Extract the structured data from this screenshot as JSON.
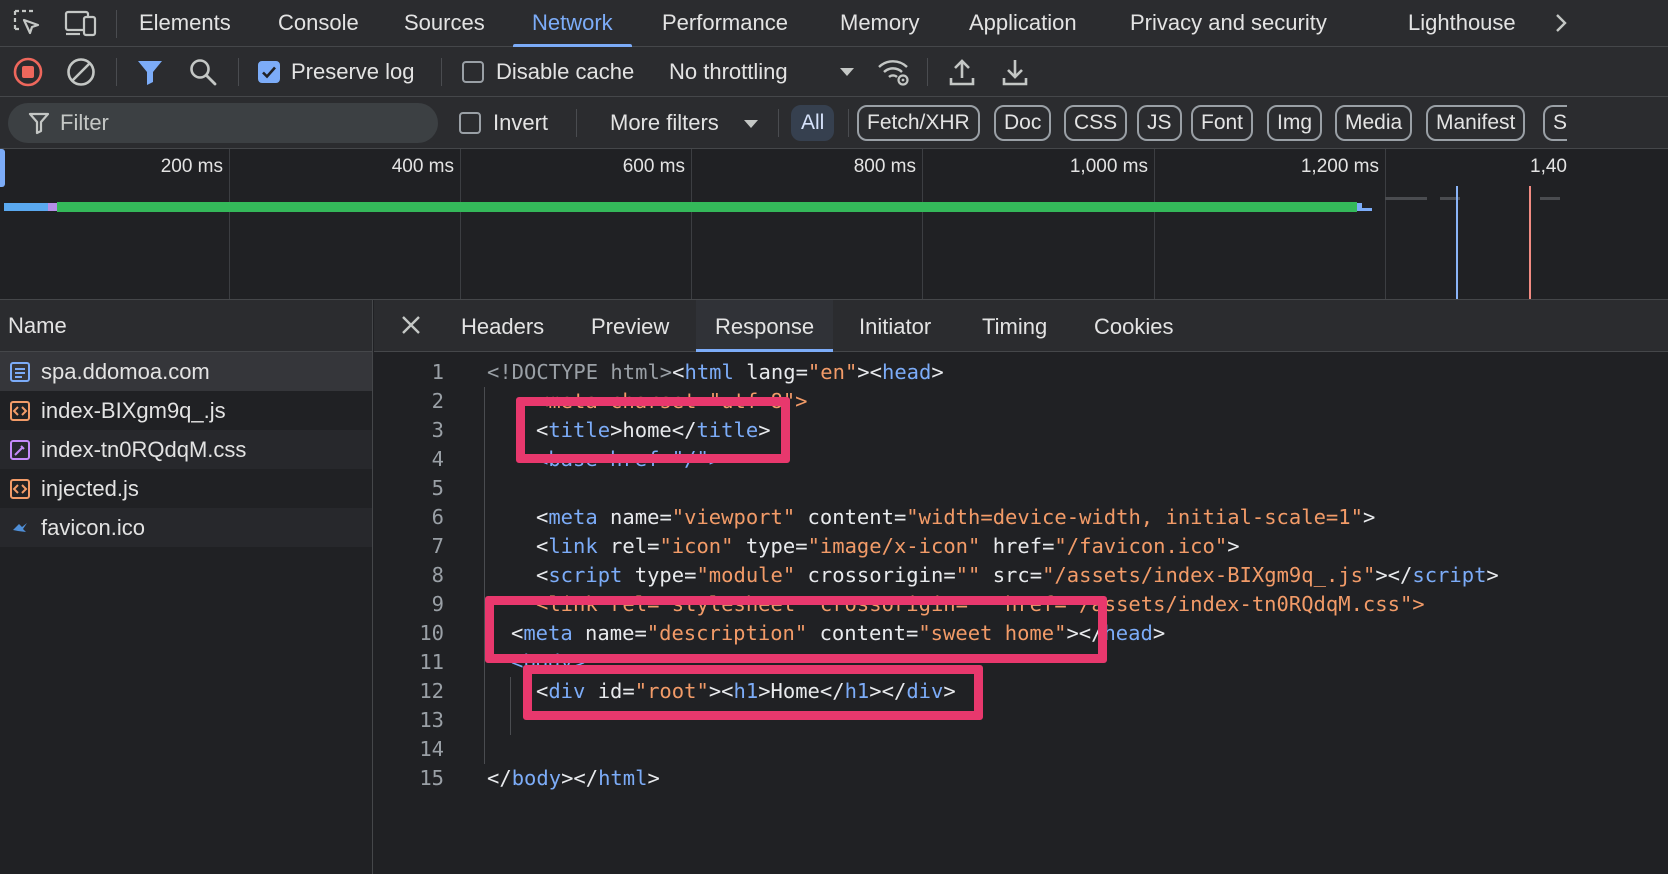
{
  "main_tabs": [
    "Elements",
    "Console",
    "Sources",
    "Network",
    "Performance",
    "Memory",
    "Application",
    "Privacy and security",
    "Lighthouse"
  ],
  "active_main_tab": "Network",
  "toolbar": {
    "preserve_log_label": "Preserve log",
    "preserve_log_checked": true,
    "disable_cache_label": "Disable cache",
    "disable_cache_checked": false,
    "throttling_value": "No throttling"
  },
  "filterbar": {
    "filter_placeholder": "Filter",
    "invert_label": "Invert",
    "more_filters_label": "More filters",
    "type_chips": [
      "All",
      "Fetch/XHR",
      "Doc",
      "CSS",
      "JS",
      "Font",
      "Img",
      "Media",
      "Manifest",
      "S"
    ],
    "active_chip": "All"
  },
  "overview": {
    "tick_labels": [
      "200 ms",
      "400 ms",
      "600 ms",
      "800 ms",
      "1,000 ms",
      "1,200 ms",
      "1,40"
    ]
  },
  "request_list": {
    "header": "Name",
    "rows": [
      {
        "name": "spa.ddomoa.com",
        "type": "doc",
        "color": "#7cacf8"
      },
      {
        "name": "index-BIXgm9q_.js",
        "type": "script",
        "color": "#f29b68"
      },
      {
        "name": "index-tn0RQdqM.css",
        "type": "stylesheet",
        "color": "#c58af9"
      },
      {
        "name": "injected.js",
        "type": "script",
        "color": "#f29b68"
      },
      {
        "name": "favicon.ico",
        "type": "image",
        "color": "#4f8fd8"
      }
    ],
    "selected": "spa.ddomoa.com"
  },
  "detail": {
    "tabs": [
      "Headers",
      "Preview",
      "Response",
      "Initiator",
      "Timing",
      "Cookies"
    ],
    "active_tab": "Response",
    "line_numbers": [
      "1",
      "2",
      "3",
      "4",
      "5",
      "6",
      "7",
      "8",
      "9",
      "10",
      "11",
      "12",
      "13",
      "14",
      "15"
    ],
    "code": {
      "l1_doctype": "<!DOCTYPE html>",
      "l1_lang_val": "\"en\"",
      "l2_partial": "<meta charset=\"utf-8\">",
      "l3_text": "home",
      "l4_partial": "<base href=\"/\">",
      "l6_name_val": "\"viewport\"",
      "l6_content_val": "\"width=device-width, initial-scale=1\"",
      "l7_rel_val": "\"icon\"",
      "l7_type_val": "\"image/x-icon\"",
      "l7_href_val": "\"/favicon.ico\"",
      "l8_type_val": "\"module\"",
      "l8_cross_val": "\"\"",
      "l8_src_val": "\"/assets/index-BIXgm9q_.js\"",
      "l9_partial": "<link rel=\"stylesheet\" crossorigin=\"\" href=\"/assets/index-tn0RQdqM.css\">",
      "l10_name_val": "\"description\"",
      "l10_content_val": "\"sweet home\"",
      "l11_partial": "<body>",
      "l12_id_val": "\"root\"",
      "l12_text": "Home"
    }
  },
  "colors": {
    "accent": "#7cacf8",
    "highlight_box": "#e8386d",
    "tag": "#7cacf8",
    "value": "#f29b68"
  }
}
